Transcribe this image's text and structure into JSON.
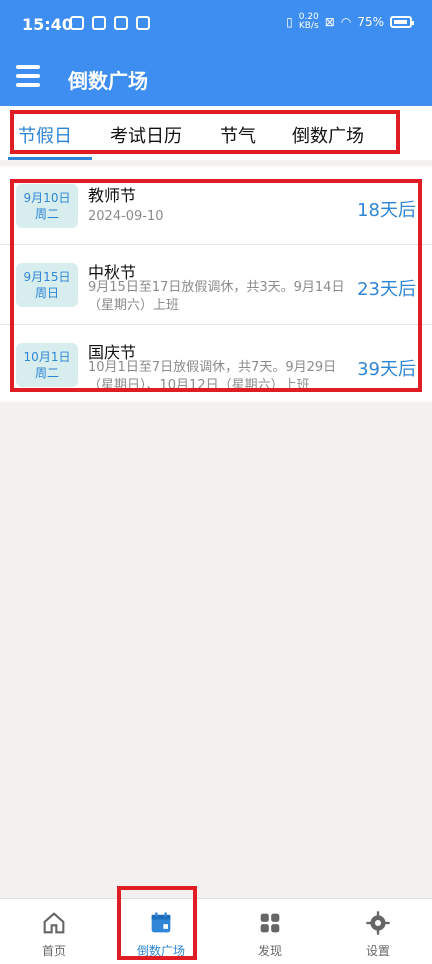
{
  "status_bar": {
    "time": "15:40",
    "network_speed_top": "0.20",
    "network_speed_bottom": "KB/s",
    "battery_percent": "75%"
  },
  "app_bar": {
    "title": "倒数广场"
  },
  "tabs": [
    {
      "label": "节假日",
      "active": true
    },
    {
      "label": "考试日历",
      "active": false
    },
    {
      "label": "节气",
      "active": false
    },
    {
      "label": "倒数广场",
      "active": false
    }
  ],
  "holidays": [
    {
      "date_line1": "9月10日",
      "date_line2": "周二",
      "title": "教师节",
      "subtitle": "2024-09-10",
      "countdown": "18天后"
    },
    {
      "date_line1": "9月15日",
      "date_line2": "周日",
      "title": "中秋节",
      "subtitle": "9月15日至17日放假调休，共3天。9月14日（星期六）上班",
      "countdown": "23天后"
    },
    {
      "date_line1": "10月1日",
      "date_line2": "周二",
      "title": "国庆节",
      "subtitle": "10月1日至7日放假调休，共7天。9月29日（星期日）、10月12日（星期六）上班",
      "countdown": "39天后"
    }
  ],
  "bottom_nav": [
    {
      "label": "首页",
      "icon": "home-icon",
      "active": false
    },
    {
      "label": "倒数广场",
      "icon": "calendar-icon",
      "active": true
    },
    {
      "label": "发现",
      "icon": "grid-icon",
      "active": false
    },
    {
      "label": "设置",
      "icon": "gear-icon",
      "active": false
    }
  ],
  "colors": {
    "primary": "#3d8ef0",
    "accent": "#2f86d6",
    "highlight": "#e01c24",
    "badge_bg": "#d8eeee"
  }
}
